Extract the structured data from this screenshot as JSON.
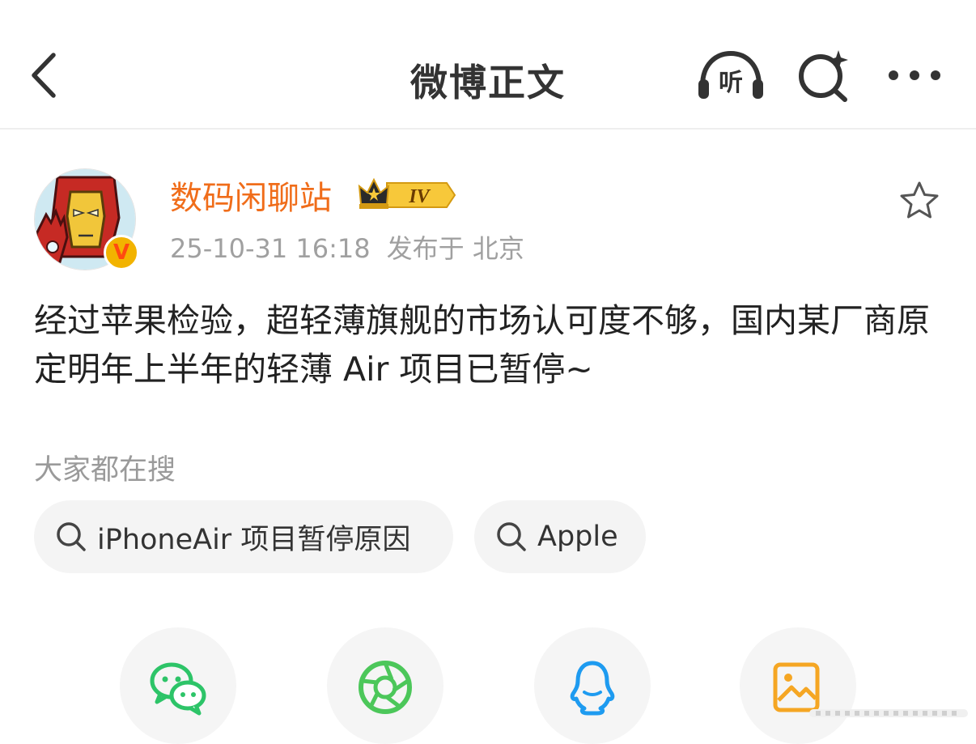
{
  "header": {
    "back_icon": "chevron-left-icon",
    "title": "微博正文",
    "listen_label": "听",
    "search_icon": "search-sparkle-icon",
    "more_icon": "more-dots-icon"
  },
  "post": {
    "author": {
      "name": "数码闲聊站",
      "verified_badge": "V",
      "rank_badge": "IV",
      "avatar_icon": "iron-man-avatar"
    },
    "time": "25-10-31 16:18",
    "location": "发布于 北京",
    "favorite_icon": "star-outline-icon",
    "content": "经过苹果检验，超轻薄旗舰的市场认可度不够，国内某厂商原定明年上半年的轻薄 Air 项目已暂停~"
  },
  "search_hint": {
    "label": "大家都在搜",
    "chips": [
      {
        "text": "iPhoneAir 项目暂停原因"
      },
      {
        "text": "Apple"
      }
    ]
  },
  "share": {
    "items": [
      {
        "icon": "wechat-icon",
        "color": "#2dc468"
      },
      {
        "icon": "moments-icon",
        "color": "#4cc75a"
      },
      {
        "icon": "qq-icon",
        "color": "#1e9bf0"
      },
      {
        "icon": "image-save-icon",
        "color": "#f5a623"
      }
    ]
  },
  "colors": {
    "username": "#f06d1a",
    "meta_gray": "#a0a0a0",
    "chip_bg": "#f4f4f4"
  }
}
